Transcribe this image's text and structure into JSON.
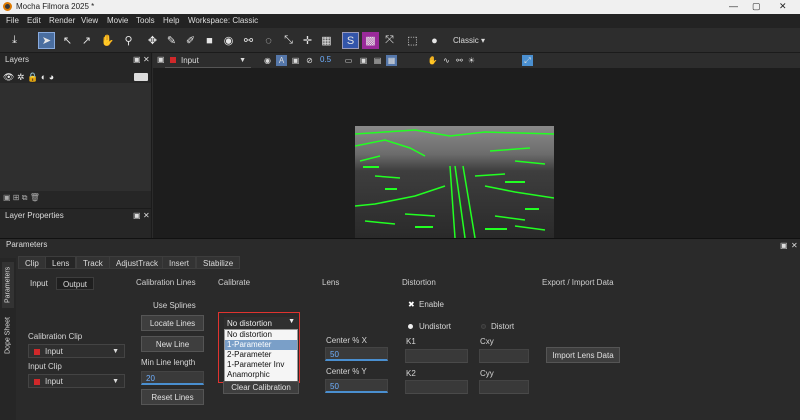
{
  "window": {
    "title": "Mocha Filmora 2025 *"
  },
  "menu": [
    "File",
    "Edit",
    "Render",
    "View",
    "Movie",
    "Tools",
    "Help",
    "Workspace: Classic"
  ],
  "toolbar": {
    "workspace": "Classic"
  },
  "viewer_bar": {
    "input_select": "Input",
    "opacity": "0.5"
  },
  "layers_panel": {
    "title": "Layers"
  },
  "layer_properties": {
    "title": "Layer Properties"
  },
  "parameters": {
    "title": "Parameters",
    "side_tabs": [
      "Parameters",
      "Dope Sheet"
    ],
    "tabs": [
      "Clip",
      "Lens",
      "Track",
      "AdjustTrack",
      "Insert",
      "Stabilize"
    ],
    "subtabs": [
      "Input",
      "Output"
    ],
    "sections": {
      "calibration_lines": "Calibration Lines",
      "calibrate": "Calibrate",
      "lens": "Lens",
      "distortion": "Distortion",
      "export_import": "Export / Import Data"
    },
    "use_splines": "Use Splines",
    "locate_lines": "Locate Lines",
    "new_line": "New Line",
    "min_line_length_label": "Min Line length",
    "min_line_length": "20",
    "reset_lines": "Reset Lines",
    "calibration_clip_label": "Calibration Clip",
    "calibration_clip": "Input",
    "input_clip_label": "Input Clip",
    "input_clip": "Input",
    "distortion_select": "No distortion",
    "distortion_options": [
      "No distortion",
      "1-Parameter",
      "2-Parameter",
      "1-Parameter Inv",
      "Anamorphic"
    ],
    "distortion_highlight": 1,
    "clear_calibration": "Clear Calibration",
    "center_x_label": "Center % X",
    "center_x": "50",
    "center_y_label": "Center % Y",
    "center_y": "50",
    "enable": "Enable",
    "undistort": "Undistort",
    "distort": "Distort",
    "k1": "K1",
    "k2": "K2",
    "cxy": "Cxy",
    "cyy": "Cyy",
    "import_lens": "Import Lens Data"
  },
  "colors": {
    "accent": "#4a8fd0",
    "highlight": "#e0332f",
    "track_green": "#22ff22"
  }
}
